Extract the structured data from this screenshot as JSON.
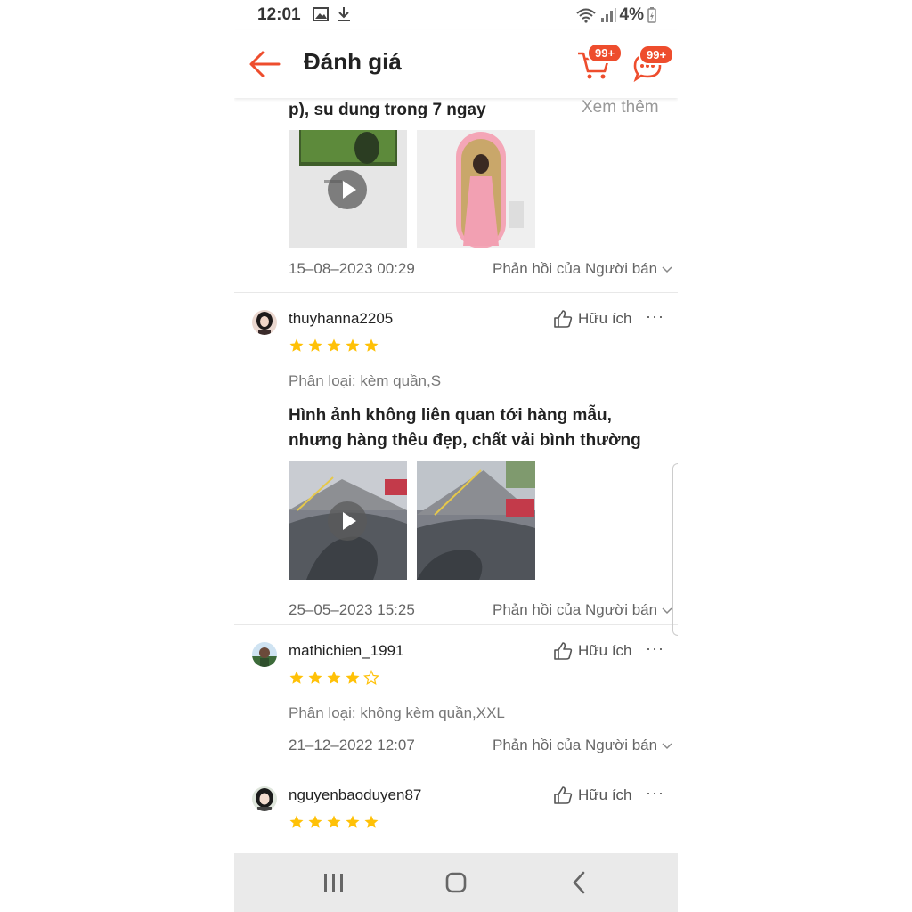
{
  "status_bar": {
    "time": "12:01",
    "battery": "4%",
    "icons": [
      "image-icon",
      "download-icon",
      "wifi-icon",
      "signal-icon",
      "battery-icon"
    ]
  },
  "header": {
    "title": "Đánh giá",
    "cart_badge": "99+",
    "chat_badge": "99+"
  },
  "top_review": {
    "comment_tail": "p), su dung trong 7 ngay",
    "see_more": "Xem thêm",
    "date": "15–08–2023 00:29",
    "reply_label": "Phản hồi của Người bán"
  },
  "reviews": [
    {
      "username": "thuyhanna2205",
      "helpful": "Hữu ích",
      "rating": 5,
      "variant": "Phân loại: kèm quần,S",
      "comment": "Hình ảnh không liên quan tới hàng mẫu, nhưng hàng thêu đẹp, chất vải bình thường",
      "date": "25–05–2023 15:25",
      "reply_label": "Phản hồi của Người bán"
    },
    {
      "username": "mathichien_1991",
      "helpful": "Hữu ích",
      "rating": 4,
      "variant": "Phân loại: không kèm quần,XXL",
      "date": "21–12–2022 12:07",
      "reply_label": "Phản hồi của Người bán"
    },
    {
      "username": "nguyenbaoduyen87",
      "helpful": "Hữu ích",
      "rating": 5
    }
  ],
  "colors": {
    "accent": "#ee4d2d",
    "star": "#ffc107",
    "text": "#222222",
    "muted": "#777777"
  }
}
